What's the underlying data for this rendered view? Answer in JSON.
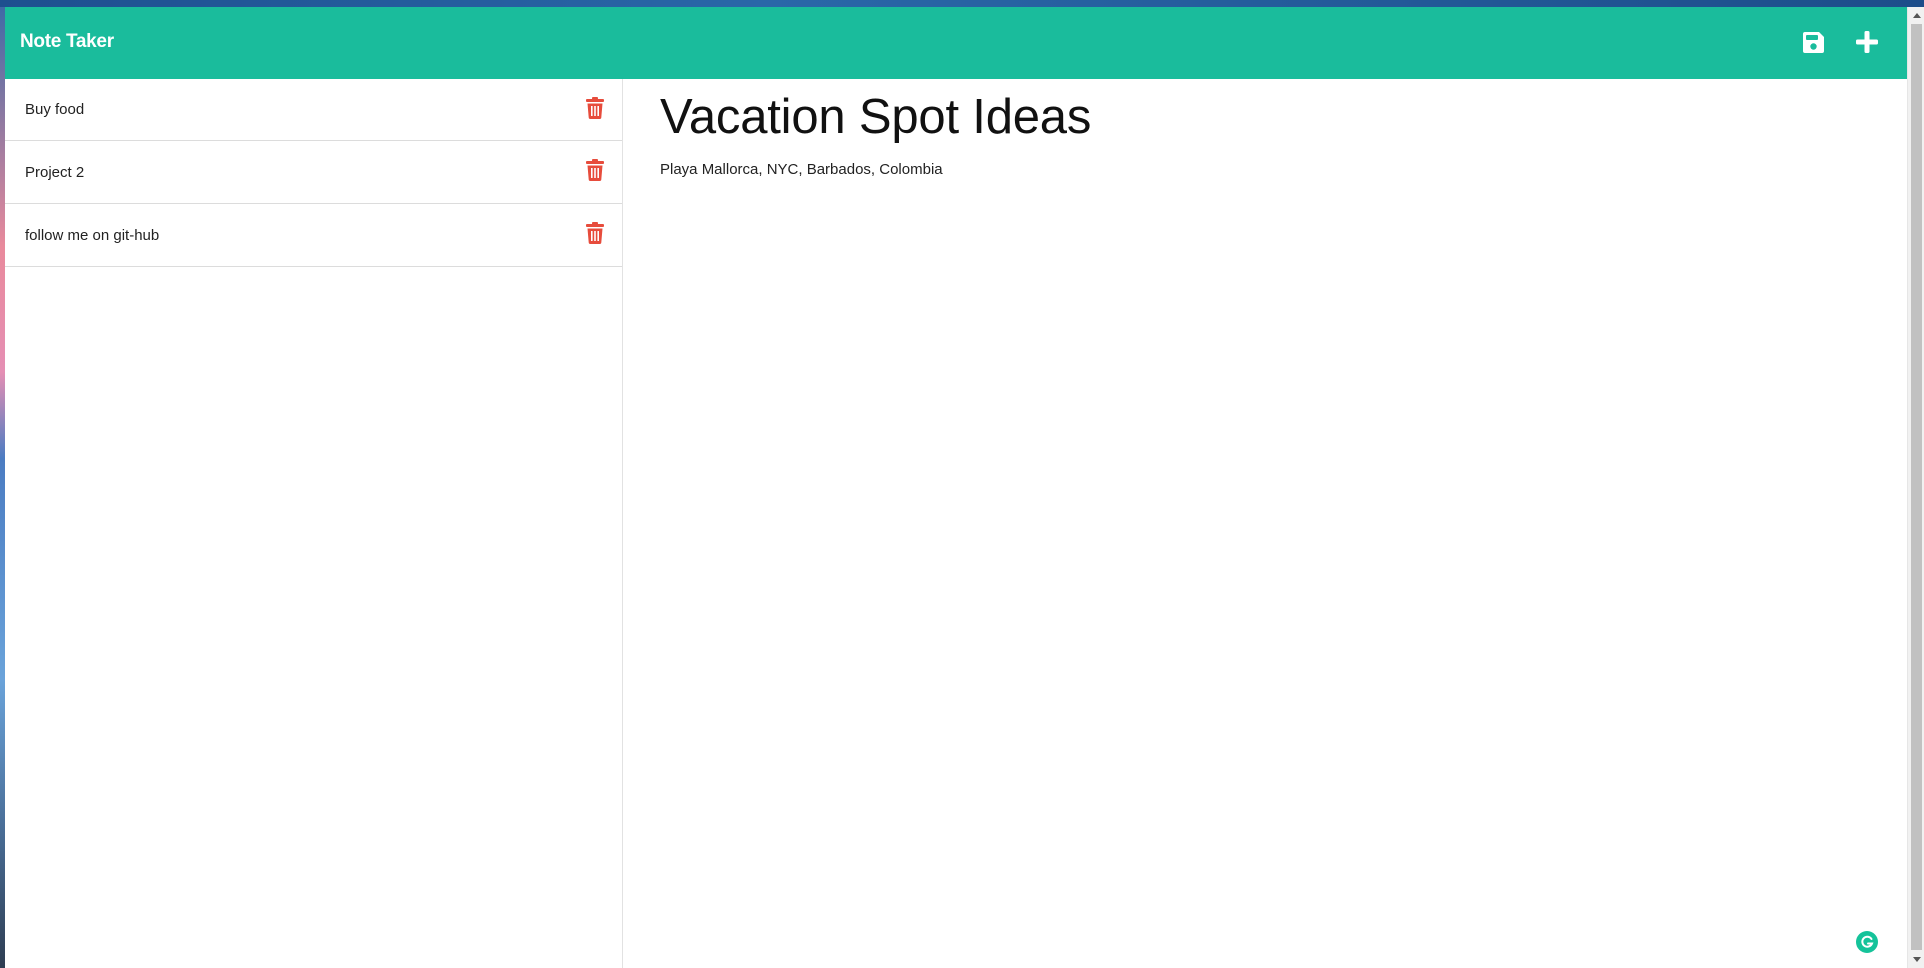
{
  "app": {
    "title": "Note Taker",
    "brand_color": "#1abc9c"
  },
  "toolbar": {
    "save_icon": "floppy-disk-icon",
    "new_icon": "plus-icon"
  },
  "notes": [
    {
      "title": "Buy food",
      "delete_icon": "trash-icon"
    },
    {
      "title": "Project 2",
      "delete_icon": "trash-icon"
    },
    {
      "title": "follow me on git-hub",
      "delete_icon": "trash-icon"
    }
  ],
  "active_note": {
    "title": "Vacation Spot Ideas",
    "text": "Playa Mallorca, NYC, Barbados, Colombia"
  },
  "colors": {
    "delete": "#e74c3c",
    "extension": "#15c39a"
  }
}
